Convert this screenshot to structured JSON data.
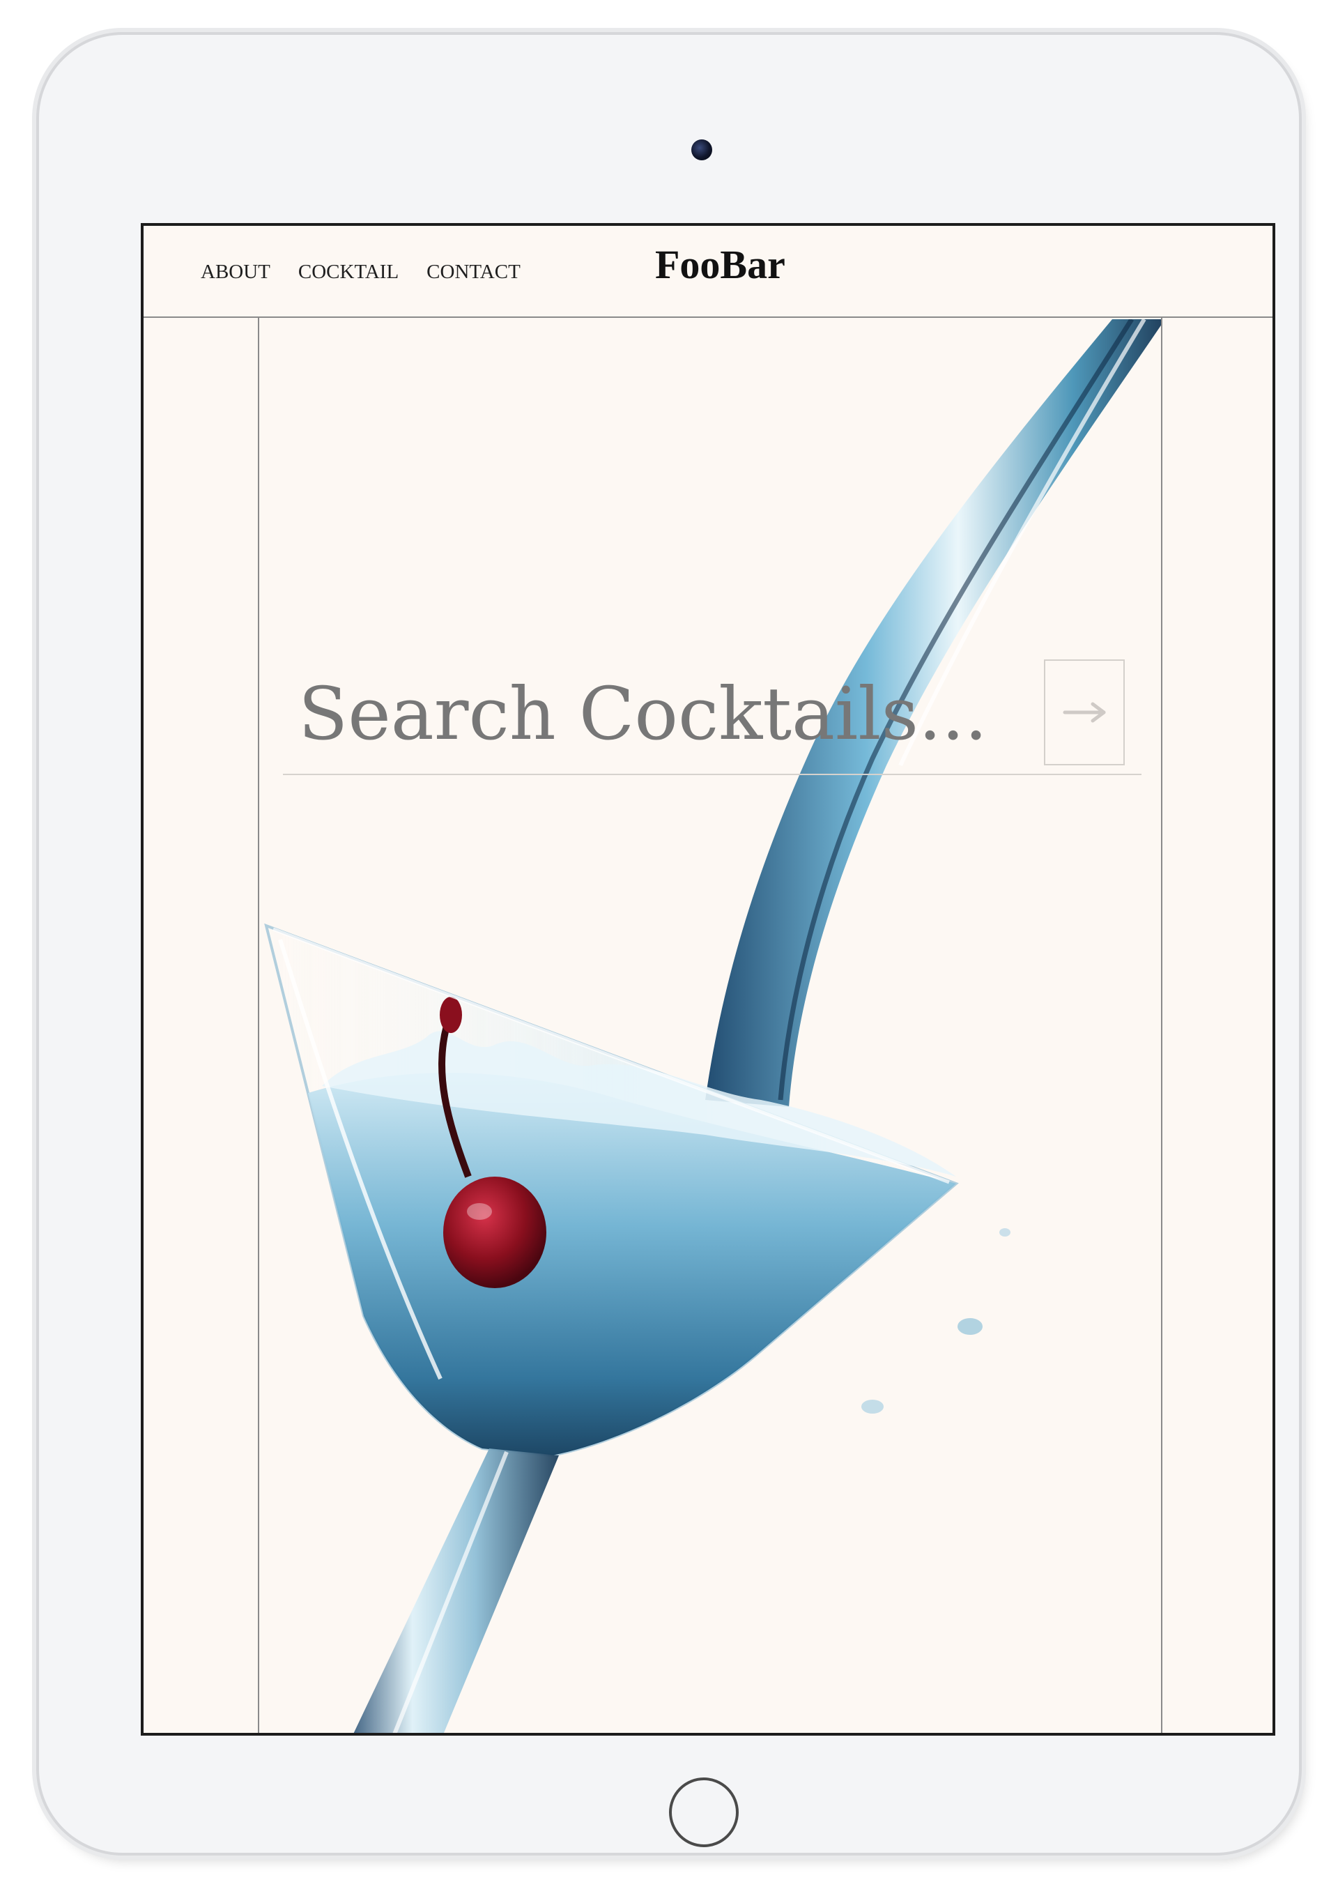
{
  "nav": {
    "items": [
      {
        "label": "ABOUT"
      },
      {
        "label": "COCKTAIL"
      },
      {
        "label": "CONTACT"
      }
    ]
  },
  "brand": {
    "name": "FooBar"
  },
  "search": {
    "placeholder": "Search Cocktails...",
    "value": ""
  },
  "hero": {
    "image": "martini-glass-pour-with-cherry"
  },
  "icons": {
    "submit": "arrow-right-icon"
  },
  "colors": {
    "background": "#fdf8f3",
    "text": "#1f1f1f",
    "drink": "#3f8fb4",
    "cherry": "#8a0f1e",
    "divider": "#8a8a8a"
  }
}
